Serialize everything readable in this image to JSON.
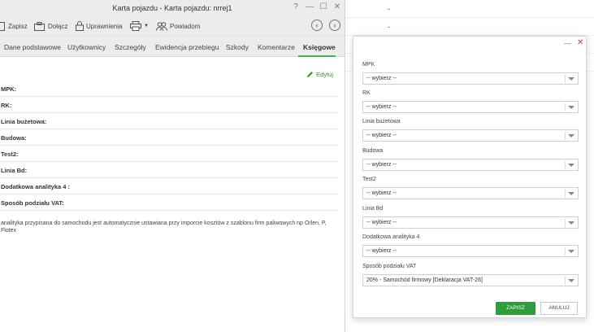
{
  "background_rows": [
    "-",
    "-"
  ],
  "window": {
    "title": "Karta pojazdu - Karta pojazdu: nrrej1",
    "help_glyph": "?",
    "minimize_glyph": "—",
    "maximize_glyph": "☐",
    "close_glyph": "✕"
  },
  "toolbar": {
    "save_label": "Zapisz",
    "attach_label": "Dołącz",
    "permissions_label": "Uprawnienia",
    "notify_label": "Powiadom",
    "back_glyph": "‹",
    "forward_glyph": "›"
  },
  "tabs": [
    {
      "label": "Dane podstawowe"
    },
    {
      "label": "Użytkownicy"
    },
    {
      "label": "Szczegóły"
    },
    {
      "label": "Ewidencja przebiegu"
    },
    {
      "label": "Szkody"
    },
    {
      "label": "Komentarze"
    },
    {
      "label": "Księgowe"
    }
  ],
  "edit_label": "Edytuj",
  "fields": [
    "MPK:",
    "RK:",
    "Linia bużetowa:",
    "Budowa:",
    "Test2:",
    "Linia Bd:",
    "Dodatkowa analityka 4 :",
    "Sposób podziału VAT:"
  ],
  "note": "analityka przypisana do samochodu jest automatycznie ustawiana przy imporcie kosztów z szablonu firm paliwowych np Orlen, P, Flotex",
  "modal": {
    "minimize_glyph": "—",
    "close_glyph": "✕",
    "fields": [
      {
        "label": "MPK",
        "value": "-- wybierz --"
      },
      {
        "label": "RK",
        "value": "-- wybierz --"
      },
      {
        "label": "Linia bużetowa",
        "value": "-- wybierz --"
      },
      {
        "label": "Budowa",
        "value": "-- wybierz --"
      },
      {
        "label": "Test2",
        "value": "-- wybierz --"
      },
      {
        "label": "Linia Bd",
        "value": "-- wybierz --"
      },
      {
        "label": "Dodatkowa analityka 4",
        "value": "-- wybierz --"
      },
      {
        "label": "Sposób podziału VAT",
        "value": "20% - Samochód firmowy [Deklaracja VAT-26]"
      }
    ],
    "save_label": "ZAPISZ",
    "cancel_label": "ANULUJ"
  },
  "colors": {
    "accent_green": "#2e9d3a",
    "tab_underline": "#4caf50",
    "close_red": "#d33333"
  }
}
